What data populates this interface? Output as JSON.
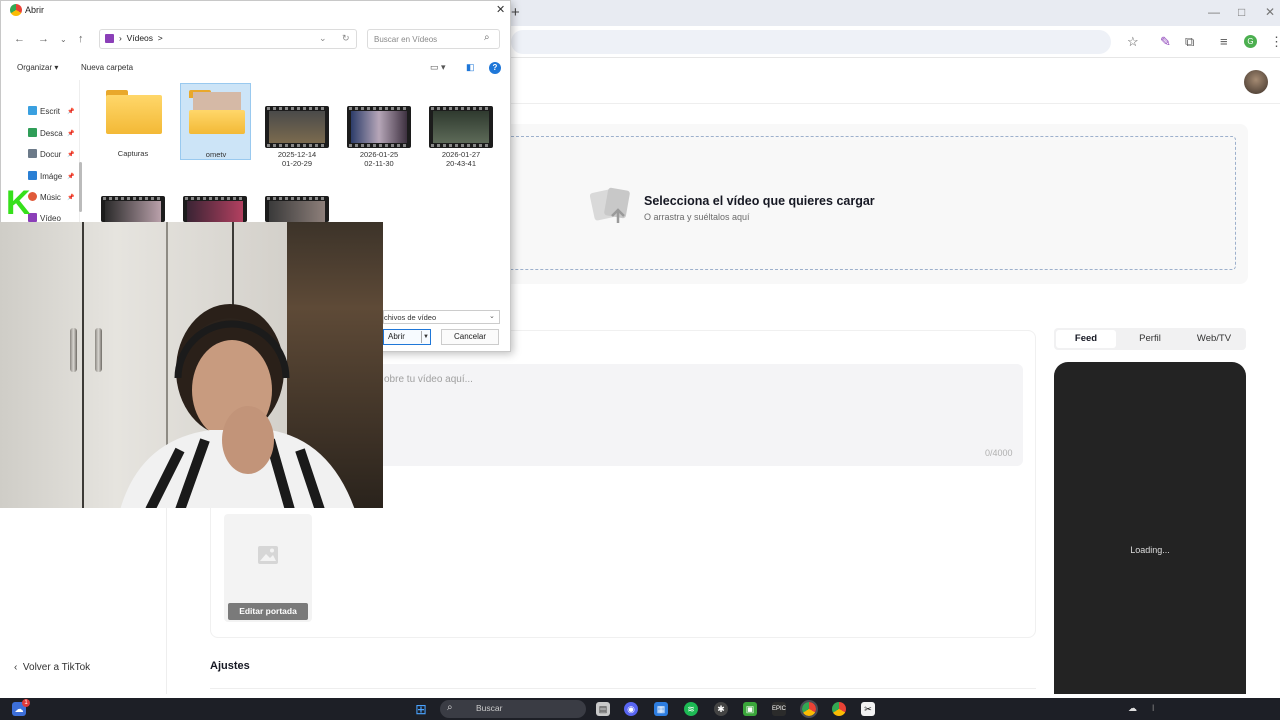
{
  "browser": {
    "new_tab_label": "+",
    "window_controls": [
      "—",
      "□",
      "✕"
    ]
  },
  "page": {
    "upload": {
      "title": "Selecciona el vídeo que quieres cargar",
      "subtitle": "O arrastra y suéltalos aquí"
    },
    "description": {
      "placeholder": "obre tu vídeo aquí...",
      "counter": "0/4000"
    },
    "cover": {
      "button": "Editar portada"
    },
    "settings_title": "Ajustes",
    "back_link": "Volver a TikTok",
    "preview_tabs": [
      "Feed",
      "Perfil",
      "Web/TV"
    ],
    "preview_active": "Feed",
    "preview_status": "Loading..."
  },
  "dialog": {
    "title": "Abrir",
    "address": {
      "location": "Vídeos",
      "separator": ">"
    },
    "search_placeholder": "Buscar en Vídeos",
    "commands": {
      "organize": "Organizar",
      "new_folder": "Nueva carpeta"
    },
    "nav_items": [
      {
        "label": "Escrit",
        "color": "#3aa0e0"
      },
      {
        "label": "Desca",
        "color": "#2f9e58"
      },
      {
        "label": "Docur",
        "color": "#6c7a89"
      },
      {
        "label": "Imáge",
        "color": "#2a7fd4"
      },
      {
        "label": "Músic",
        "color": "#e05a3a"
      },
      {
        "label": "Vídeo",
        "color": "#8b3fb8"
      }
    ],
    "files": [
      {
        "type": "folder",
        "label": "Capturas"
      },
      {
        "type": "folder",
        "label": "ometv",
        "selected": true
      },
      {
        "type": "video",
        "label": "2025-12-14\n01-20-29"
      },
      {
        "type": "video",
        "label": "2026-01-25\n02-11-30"
      },
      {
        "type": "video",
        "label": "2026-01-27\n20-43-41"
      }
    ],
    "file_type_filter": "chivos de vídeo",
    "open_button": "Abrir",
    "cancel_button": "Cancelar"
  },
  "taskbar": {
    "search_placeholder": "Buscar",
    "notification_count": "1"
  }
}
